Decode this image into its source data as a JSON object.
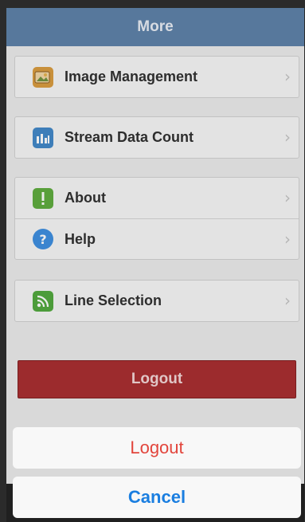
{
  "navbar": {
    "title": "More"
  },
  "groups": [
    {
      "items": [
        {
          "label": "Image Management",
          "icon": "image-icon",
          "color": "#d99a3c"
        }
      ]
    },
    {
      "items": [
        {
          "label": "Stream Data Count",
          "icon": "bar-chart-icon",
          "color": "#3f86c8"
        }
      ]
    },
    {
      "items": [
        {
          "label": "About",
          "icon": "exclamation-icon",
          "color": "#5cab3a"
        },
        {
          "label": "Help",
          "icon": "question-icon",
          "color": "#3a8de0"
        }
      ]
    },
    {
      "items": [
        {
          "label": "Line Selection",
          "icon": "rss-icon",
          "color": "#4ea83a"
        }
      ]
    }
  ],
  "logout_button": {
    "label": "Logout",
    "color": "#a82a2c"
  },
  "action_sheet": {
    "logout_label": "Logout",
    "cancel_label": "Cancel",
    "destructive_color": "#e2453c",
    "cancel_color": "#1a7ee0"
  }
}
